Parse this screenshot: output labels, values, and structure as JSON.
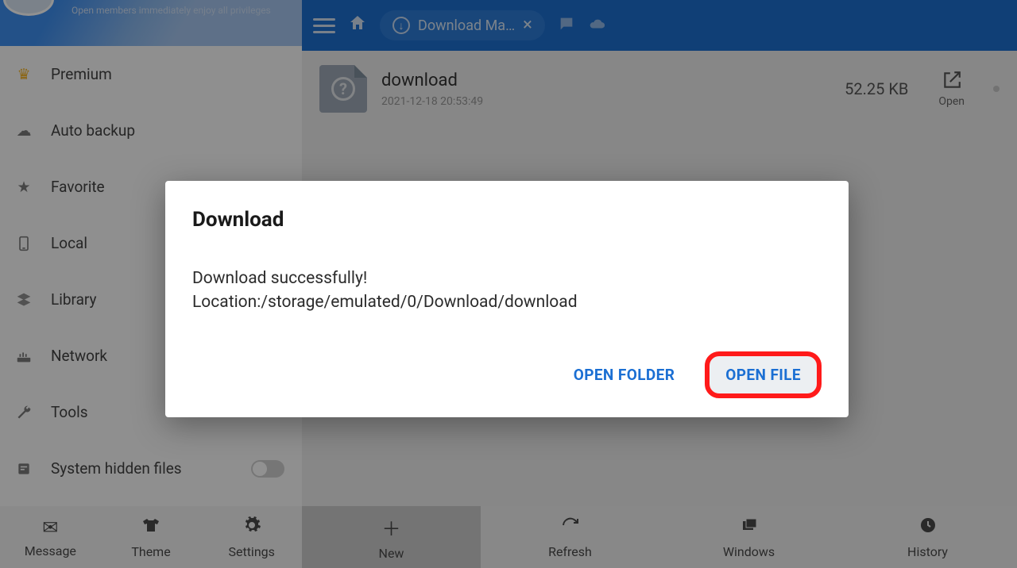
{
  "sidebar": {
    "header_subtitle": "Open members immediately enjoy all privileges",
    "items": [
      {
        "label": "Premium"
      },
      {
        "label": "Auto backup"
      },
      {
        "label": "Favorite"
      },
      {
        "label": "Local"
      },
      {
        "label": "Library"
      },
      {
        "label": "Network"
      },
      {
        "label": "Tools"
      },
      {
        "label": "System hidden files"
      }
    ]
  },
  "topbar": {
    "tab_label": "Download Ma…"
  },
  "file": {
    "name": "download",
    "date": "2021-12-18 20:53:49",
    "size": "52.25 KB",
    "open_label": "Open"
  },
  "bottom_left": {
    "message": "Message",
    "theme": "Theme",
    "settings": "Settings"
  },
  "bottom_right": {
    "new": "New",
    "refresh": "Refresh",
    "windows": "Windows",
    "history": "History"
  },
  "dialog": {
    "title": "Download",
    "line1": "Download  successfully!",
    "line2": "Location:/storage/emulated/0/Download/download",
    "open_folder": "OPEN FOLDER",
    "open_file": "OPEN FILE"
  }
}
